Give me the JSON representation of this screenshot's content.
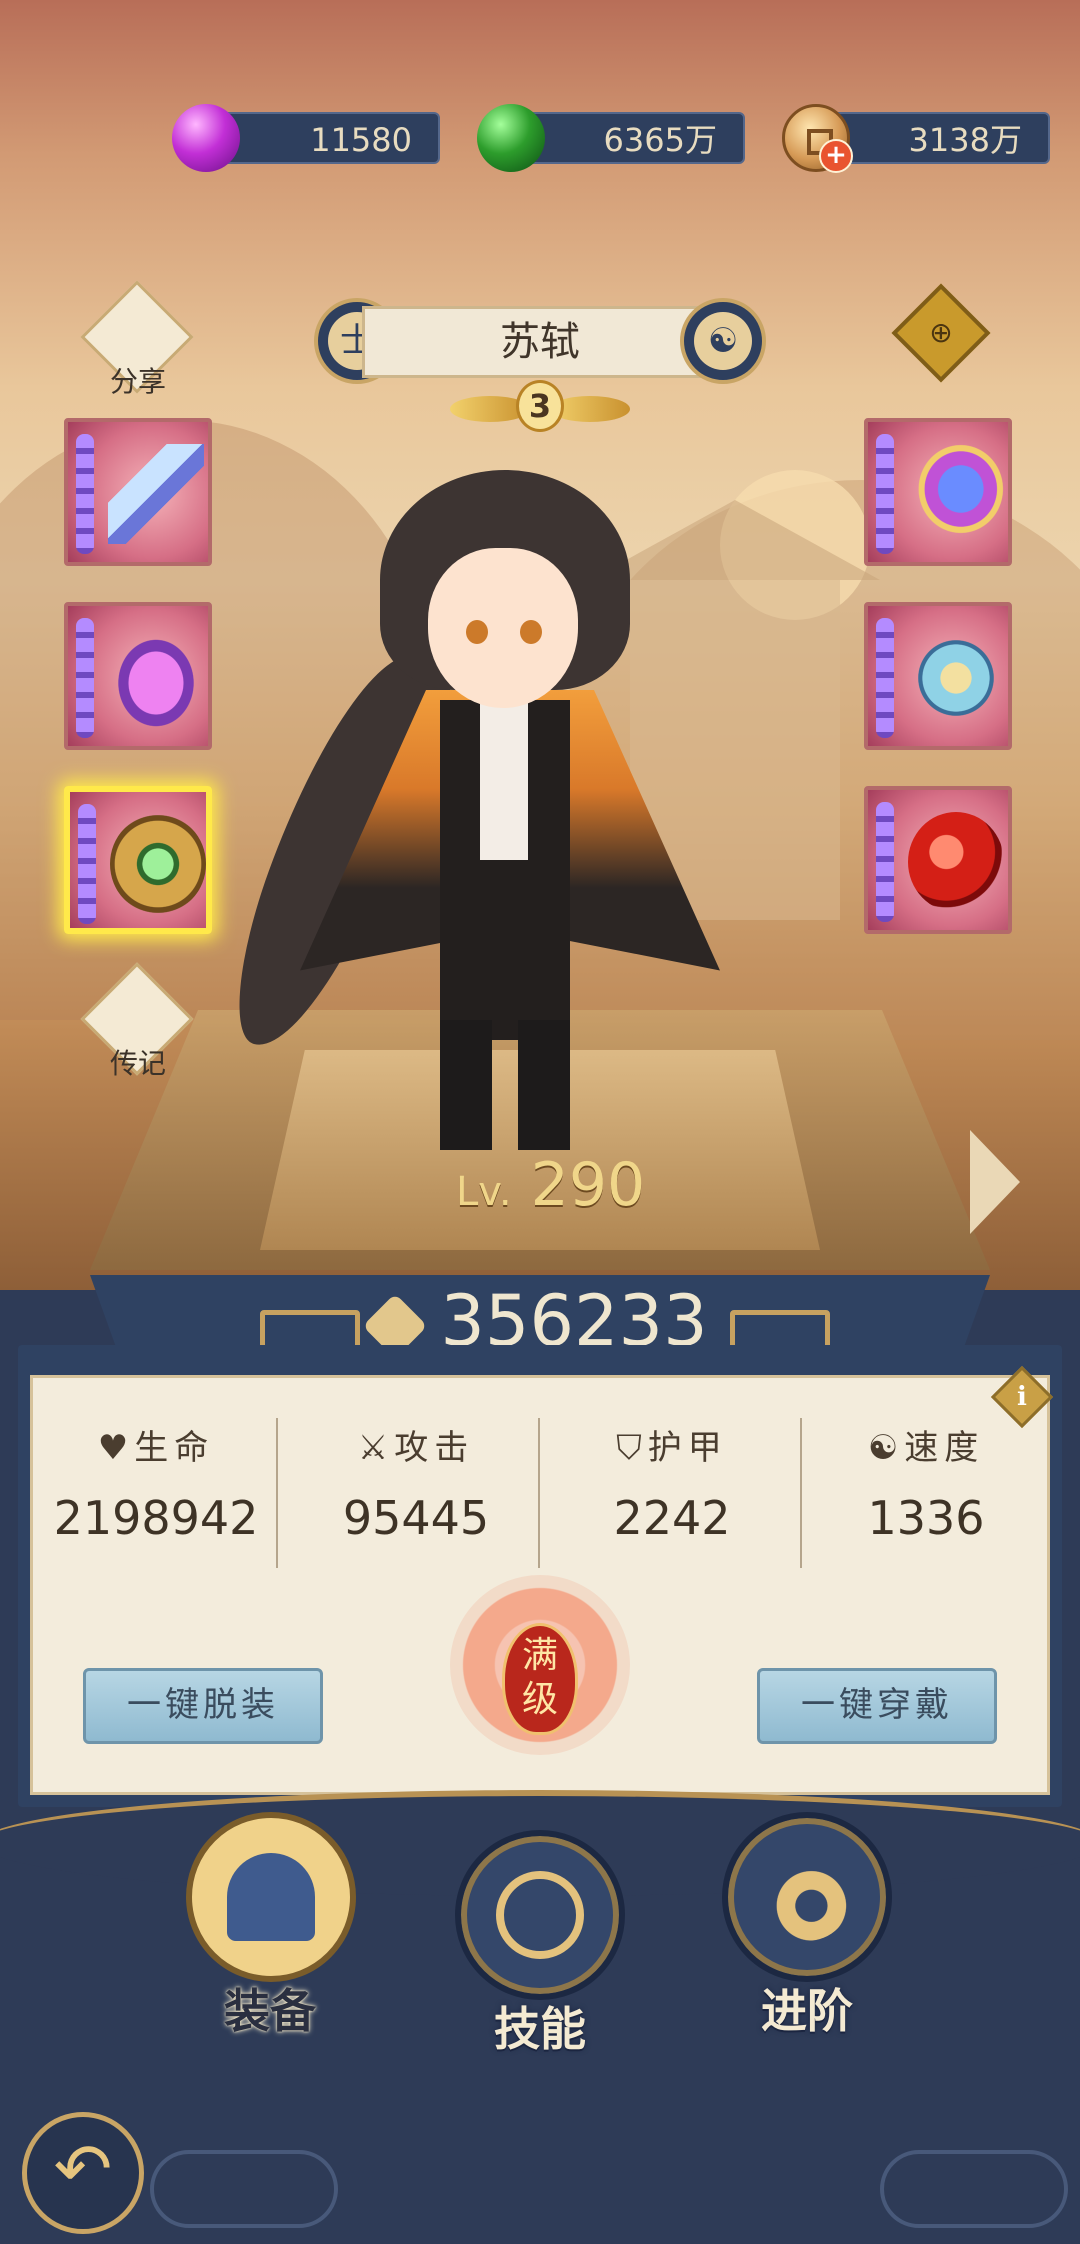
{
  "currencies": [
    {
      "icon": "purple-gem-icon",
      "value": "11580"
    },
    {
      "icon": "green-gem-icon",
      "value": "6365万"
    },
    {
      "icon": "copper-coin-icon",
      "value": "3138万"
    }
  ],
  "hero": {
    "name": "苏轼",
    "class_icon_text": "士",
    "star": "3",
    "level_prefix": "Lv.",
    "level": "290",
    "power": "356233"
  },
  "side": {
    "share_label": "分享",
    "biography_label": "传记"
  },
  "equipment": {
    "left": [
      {
        "name": "weapon",
        "icon": "blade-icon"
      },
      {
        "name": "armor",
        "icon": "robe-icon"
      },
      {
        "name": "accessory",
        "icon": "jade-ring-icon",
        "selected": true
      }
    ],
    "right": [
      {
        "name": "boots",
        "icon": "boots-icon"
      },
      {
        "name": "amulet",
        "icon": "amulet-icon"
      },
      {
        "name": "treasure",
        "icon": "red-orb-icon"
      }
    ]
  },
  "stats": [
    {
      "label": "生命",
      "icon": "heart-icon",
      "value": "2198942"
    },
    {
      "label": "攻击",
      "icon": "crossed-swords-icon",
      "value": "95445"
    },
    {
      "label": "护甲",
      "icon": "shield-icon",
      "value": "2242"
    },
    {
      "label": "速度",
      "icon": "speed-icon",
      "value": "1336"
    }
  ],
  "actions": {
    "unequip_all": "一键脱装",
    "equip_all": "一键穿戴",
    "max_level_badge": "满级"
  },
  "info_icon_text": "i",
  "nav": [
    {
      "label": "装备",
      "icon": "helmet-icon",
      "active": true
    },
    {
      "label": "技能",
      "icon": "skill-icon",
      "active": false
    },
    {
      "label": "进阶",
      "icon": "advance-icon",
      "active": false
    }
  ],
  "colors": {
    "panel_navy": "#2f4262",
    "gold_accent": "#c9a565",
    "selection_glow": "#ffe94a"
  }
}
